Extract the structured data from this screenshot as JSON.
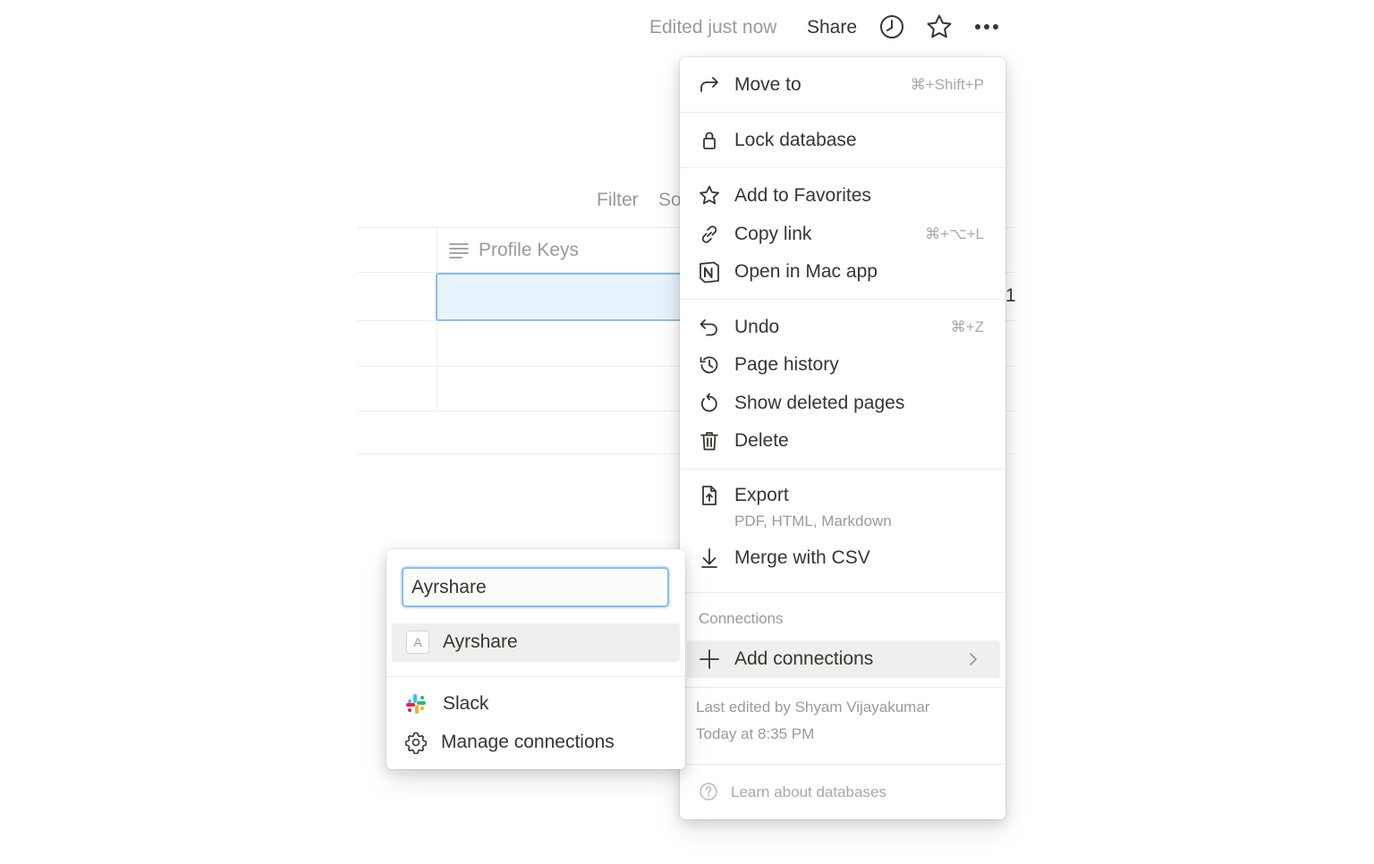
{
  "topbar": {
    "edited": "Edited just now",
    "share": "Share",
    "icons": [
      "clock-icon",
      "star-icon",
      "more-icon"
    ]
  },
  "background": {
    "filter": "Filter",
    "sort_partial": "So",
    "column_header": "Profile Keys",
    "edge_digit": "1"
  },
  "menu": {
    "move_to": {
      "label": "Move to",
      "shortcut": "⌘+Shift+P"
    },
    "lock": {
      "label": "Lock database"
    },
    "favorites": {
      "label": "Add to Favorites"
    },
    "copy_link": {
      "label": "Copy link",
      "shortcut": "⌘+⌥+L"
    },
    "open_mac": {
      "label": "Open in Mac app"
    },
    "undo": {
      "label": "Undo",
      "shortcut": "⌘+Z"
    },
    "page_history": {
      "label": "Page history"
    },
    "show_deleted": {
      "label": "Show deleted pages"
    },
    "delete": {
      "label": "Delete"
    },
    "export": {
      "label": "Export",
      "sublabel": "PDF, HTML, Markdown"
    },
    "merge_csv": {
      "label": "Merge with CSV"
    },
    "connections_label": "Connections",
    "add_connections": {
      "label": "Add connections"
    },
    "last_edited_by": "Last edited by Shyam Vijayakumar",
    "last_edited_time": "Today at 8:35 PM",
    "learn": "Learn about databases"
  },
  "connections_menu": {
    "search_value": "Ayrshare",
    "result": {
      "badge": "A",
      "label": "Ayrshare"
    },
    "slack": "Slack",
    "manage": "Manage connections"
  },
  "colors": {
    "text": "#37352f",
    "muted": "#9b9a97",
    "highlight": "#efefee",
    "focus": "#8dbde6",
    "selected_cell": "#e8f2fb"
  }
}
